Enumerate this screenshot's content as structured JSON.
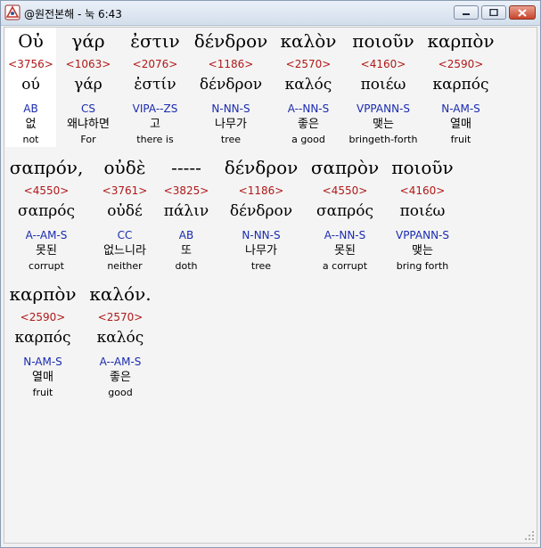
{
  "window": {
    "title": "@원전본해 - 눅 6:43"
  },
  "words": [
    {
      "greek": "Οὐ",
      "strong": "<3756>",
      "lemma": "ού",
      "morph": "AB",
      "korean": "없",
      "english": "not"
    },
    {
      "greek": "γάρ",
      "strong": "<1063>",
      "lemma": "γάρ",
      "morph": "CS",
      "korean": "왜냐하면",
      "english": "For"
    },
    {
      "greek": "ἐστιν",
      "strong": "<2076>",
      "lemma": "ἐστίν",
      "morph": "VIPA--ZS",
      "korean": "고",
      "english": "there is"
    },
    {
      "greek": "δένδρον",
      "strong": "<1186>",
      "lemma": "δένδρον",
      "morph": "N-NN-S",
      "korean": "나무가",
      "english": "tree"
    },
    {
      "greek": "καλὸν",
      "strong": "<2570>",
      "lemma": "καλός",
      "morph": "A--NN-S",
      "korean": "좋은",
      "english": "a good"
    },
    {
      "greek": "ποιοῦν",
      "strong": "<4160>",
      "lemma": "ποιέω",
      "morph": "VPPANN-S",
      "korean": "맺는",
      "english": "bringeth-forth"
    },
    {
      "greek": "καρπὸν",
      "strong": "<2590>",
      "lemma": "καρπός",
      "morph": "N-AM-S",
      "korean": "열매",
      "english": "fruit"
    },
    {
      "greek": "σαπρόν,",
      "strong": "<4550>",
      "lemma": "σαπρός",
      "morph": "A--AM-S",
      "korean": "못된",
      "english": "corrupt"
    },
    {
      "greek": "οὐδὲ",
      "strong": "<3761>",
      "lemma": "οὐδέ",
      "morph": "CC",
      "korean": "없느니라",
      "english": "neither"
    },
    {
      "greek": "-----",
      "strong": "<3825>",
      "lemma": "πάλιν",
      "morph": "AB",
      "korean": "또",
      "english": "doth"
    },
    {
      "greek": "δένδρον",
      "strong": "<1186>",
      "lemma": "δένδρον",
      "morph": "N-NN-S",
      "korean": "나무가",
      "english": "tree"
    },
    {
      "greek": "σαπρὸν",
      "strong": "<4550>",
      "lemma": "σαπρός",
      "morph": "A--NN-S",
      "korean": "못된",
      "english": "a corrupt"
    },
    {
      "greek": "ποιοῦν",
      "strong": "<4160>",
      "lemma": "ποιέω",
      "morph": "VPPANN-S",
      "korean": "맺는",
      "english": "bring forth"
    },
    {
      "greek": "καρπὸν",
      "strong": "<2590>",
      "lemma": "καρπός",
      "morph": "N-AM-S",
      "korean": "열매",
      "english": "fruit"
    },
    {
      "greek": "καλόν.",
      "strong": "<2570>",
      "lemma": "καλός",
      "morph": "A--AM-S",
      "korean": "좋은",
      "english": "good"
    }
  ]
}
